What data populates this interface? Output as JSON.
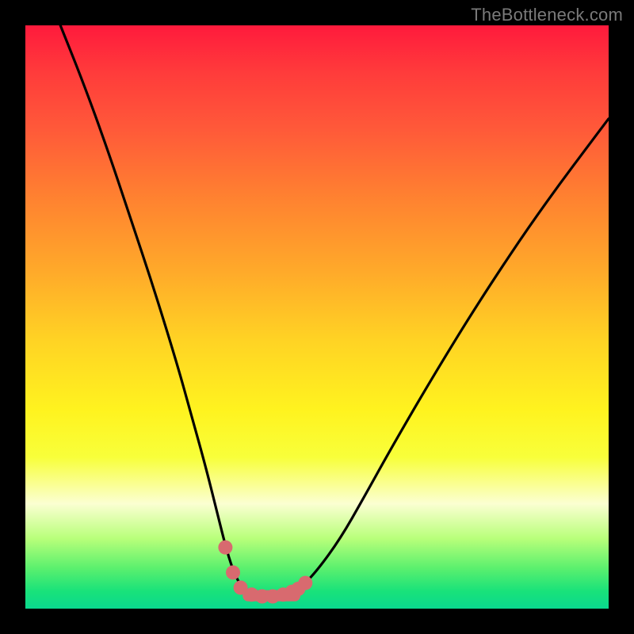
{
  "watermark": "TheBottleneck.com",
  "colors": {
    "frame": "#000000",
    "curve_stroke": "#000000",
    "marker_fill": "#d86a6f",
    "marker_stroke": "#d86a6f"
  },
  "chart_data": {
    "type": "line",
    "title": "",
    "xlabel": "",
    "ylabel": "",
    "xlim": [
      0,
      100
    ],
    "ylim": [
      0,
      100
    ],
    "grid": false,
    "legend": false,
    "series": [
      {
        "name": "bottleneck-curve",
        "x": [
          6,
          10,
          14,
          18,
          22,
          26,
          28.5,
          31,
          33,
          34.5,
          36,
          37.5,
          39,
          41,
          43,
          45,
          47,
          50,
          54,
          58,
          63,
          70,
          78,
          88,
          100
        ],
        "y": [
          100,
          90,
          79,
          67,
          55,
          42,
          33,
          24,
          16,
          10,
          5.5,
          3.2,
          2.4,
          2.1,
          2.1,
          2.4,
          3.4,
          6.5,
          12,
          19,
          28,
          40,
          53,
          68,
          84
        ]
      }
    ],
    "markers": [
      {
        "x": 34.3,
        "y": 10.5
      },
      {
        "x": 35.6,
        "y": 6.2
      },
      {
        "x": 36.9,
        "y": 3.6
      },
      {
        "x": 38.8,
        "y": 2.4
      },
      {
        "x": 40.6,
        "y": 2.1
      },
      {
        "x": 42.4,
        "y": 2.1
      },
      {
        "x": 44.2,
        "y": 2.4
      },
      {
        "x": 45.7,
        "y": 2.9
      },
      {
        "x": 46.8,
        "y": 3.4
      },
      {
        "x": 48.0,
        "y": 4.4
      }
    ],
    "flat_segment": {
      "x_start": 38.2,
      "x_end": 46.2,
      "y": 2.2
    }
  }
}
